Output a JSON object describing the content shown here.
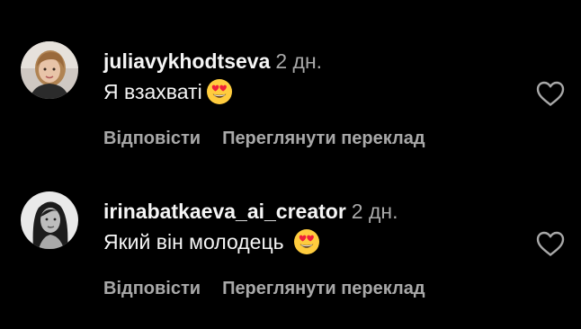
{
  "theme": {
    "background": "#000000",
    "text_primary": "#f5f5f5",
    "text_secondary": "#a8a8a8",
    "emoji_face": "#ffcc3e",
    "emoji_heart": "#f0203a"
  },
  "comments": [
    {
      "username": "juliavykhodtseva",
      "time": "2 дн.",
      "text": "Я взахваті",
      "emoji": "smiling-face-with-heart-eyes",
      "reply_label": "Відповісти",
      "translate_label": "Переглянути переклад",
      "like_icon": "heart-outline-icon"
    },
    {
      "username": "irinabatkaeva_ai_creator",
      "time": "2 дн.",
      "text": "Який він молодець",
      "emoji": "smiling-face-with-heart-eyes",
      "reply_label": "Відповісти",
      "translate_label": "Переглянути переклад",
      "like_icon": "heart-outline-icon"
    }
  ]
}
